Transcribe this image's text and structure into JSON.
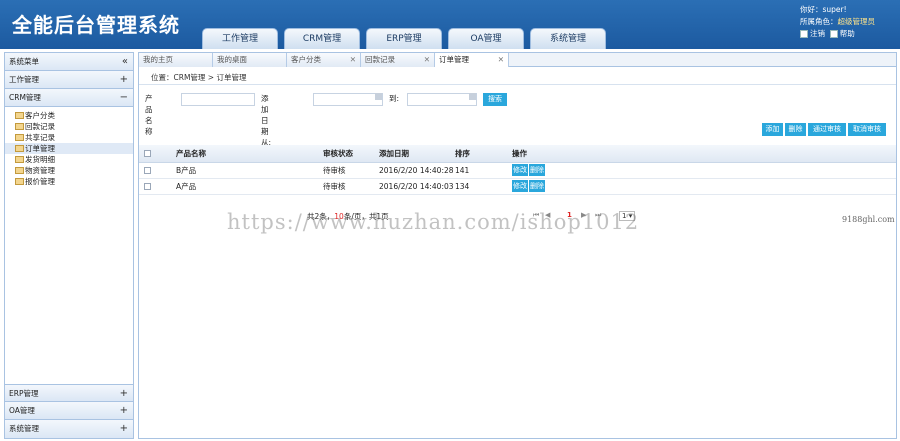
{
  "app_title": "全能后台管理系统",
  "nav_tabs": [
    "工作管理",
    "CRM管理",
    "ERP管理",
    "OA管理",
    "系统管理"
  ],
  "user": {
    "greeting": "你好：super!",
    "role_label": "所属角色：",
    "role_value": "超级管理员",
    "logout": "注销",
    "help": "帮助"
  },
  "sidebar": {
    "title": "系统菜单",
    "collapse_glyph": "«",
    "groups": [
      {
        "label": "工作管理",
        "toggle": "+"
      },
      {
        "label": "CRM管理",
        "toggle": "−"
      }
    ],
    "crm_items": [
      "客户分类",
      "回款记录",
      "共享记录",
      "订单管理",
      "发货明细",
      "物资管理",
      "报价管理"
    ],
    "bottom_groups": [
      {
        "label": "ERP管理",
        "toggle": "+"
      },
      {
        "label": "OA管理",
        "toggle": "+"
      },
      {
        "label": "系统管理",
        "toggle": "+"
      }
    ]
  },
  "page_tabs": [
    {
      "label": "我的主页",
      "closable": false
    },
    {
      "label": "我的桌面",
      "closable": false
    },
    {
      "label": "客户分类",
      "closable": true
    },
    {
      "label": "回款记录",
      "closable": true
    },
    {
      "label": "订单管理",
      "closable": true
    }
  ],
  "breadcrumb": "位置：CRM管理 > 订单管理",
  "search": {
    "product_label": "产品名称",
    "date_label": "添加日期 从:",
    "to_label": "到:",
    "button": "搜索"
  },
  "toolbar": [
    "添加",
    "删除",
    "通过审核",
    "取消审核"
  ],
  "table": {
    "headers": [
      "产品名称",
      "审核状态",
      "添加日期",
      "排序",
      "操作"
    ],
    "rows": [
      {
        "name": "B产品",
        "status": "待审核",
        "date": "2016/2/20 14:40:28",
        "sort": "141"
      },
      {
        "name": "A产品",
        "status": "待审核",
        "date": "2016/2/20 14:40:03",
        "sort": "134"
      }
    ],
    "edit_label": "修改",
    "delete_label": "删除"
  },
  "pager": {
    "total_prefix": "共2条，",
    "page_size": "10",
    "page_size_suffix": "条/页，共1页",
    "current_page": "1",
    "page_select": "1"
  },
  "watermark": "https://www.huzhan.com/ishop1012",
  "watermark2": "9188ghl.com",
  "colors": {
    "header": "#1c5aa0",
    "button": "#2aa7dc",
    "border": "#a9c3e2"
  }
}
